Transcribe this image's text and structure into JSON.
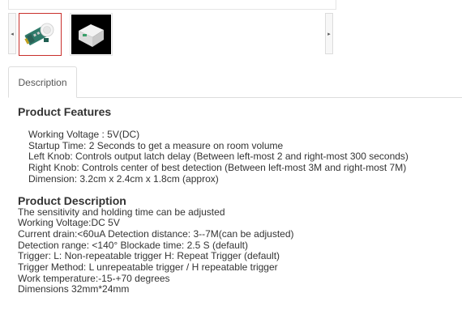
{
  "gallery": {
    "prev_arrow": "◂",
    "next_arrow": "▸",
    "thumbnails": [
      {
        "icon": "pir-sensor-module-image",
        "selected": true
      },
      {
        "icon": "white-box-image",
        "selected": false
      }
    ]
  },
  "tabs": [
    {
      "label": "Description",
      "active": true
    }
  ],
  "product_features": {
    "title": "Product Features",
    "items": [
      "Working Voltage : 5V(DC)",
      "Startup Time: 2 Seconds to get a measure on room volume",
      "Left Knob: Controls output latch delay (Between left-most 2 and right-most 300 seconds)",
      "Right Knob: Controls center of best detection (Between left-most 3M and right-most 7M)",
      "Dimension: 3.2cm x 2.4cm x 1.8cm (approx)"
    ]
  },
  "product_description": {
    "title": "Product Description",
    "lines": [
      "The sensitivity and holding time can be adjusted",
      "Working Voltage:DC 5V",
      "Current drain:<60uA Detection distance: 3--7M(can be adjusted)",
      "Detection range: <140° Blockade time: 2.5 S (default)",
      "Trigger: L: Non-repeatable trigger H: Repeat Trigger (default)",
      "Trigger Method: L unrepeatable trigger / H repeatable trigger",
      "Work temperature:-15-+70 degrees",
      "Dimensions 32mm*24mm"
    ]
  },
  "colors": {
    "selected_border": "#c9302c",
    "border": "#dddddd",
    "text": "#333333"
  }
}
